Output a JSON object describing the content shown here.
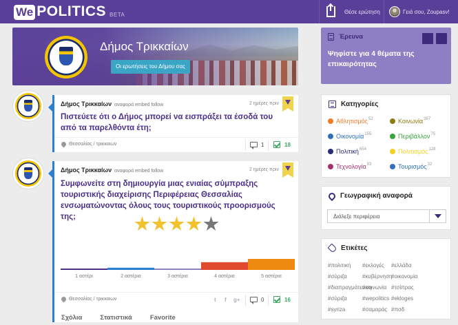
{
  "header": {
    "logo_we": "We",
    "logo_politics": "POLITICS",
    "logo_beta": "BETA",
    "ask_label": "Θέσε ερώτηση",
    "user_greeting": "Γειά σου, Zoupasv!"
  },
  "banner": {
    "title": "Δήμος Τρικκαίων",
    "button": "Οι ερωτήσεις του Δήμου σας"
  },
  "posts": [
    {
      "author": "Δήμος Τρικκαίων",
      "meta": "αναφορά embed follow",
      "time": "2 ημέρες πριν",
      "question": "Πιστεύετε ότι ο Δήμος μπορεί να εισπράξει τα έσοδά του από τα παρελθόντα έτη;",
      "location": "Θεσσαλίας / τρικκαιων",
      "comments": "1",
      "answers": "18"
    },
    {
      "author": "Δήμος Τρικκαίων",
      "meta": "αναφορά embed follow",
      "time": "2 ημέρες πριν",
      "question": "Συμφωνείτε στη δημιουργία μιας ενιαίας σύμπραξης τουριστικής διαχείρισης Περιφέρειας Θεσσαλίας ενσωματώνοντας όλους τους τουριστικούς προορισμούς της;",
      "location": "Θεσσαλίας / τρικκαιων",
      "social": [
        "t",
        "f",
        "g+"
      ],
      "comments": "0",
      "answers": "16",
      "rating": {
        "value": 4,
        "max": 5,
        "filled_color": "#f2c12e",
        "empty_color": "#777777"
      },
      "tabs": [
        "Σχόλια",
        "Στατιστικά",
        "Favorite"
      ]
    }
  ],
  "chart_data": {
    "type": "bar",
    "categories": [
      "1 αστέρι",
      "2 αστέρια",
      "3 αστέρια",
      "4 αστέρια",
      "5 αστέρια"
    ],
    "values": [
      1,
      2,
      1,
      7,
      10
    ],
    "colors": [
      "#4a2f8a",
      "#2d7fd2",
      "#8e7fc4",
      "#e04a2f",
      "#ee8a10"
    ],
    "ylim": [
      0,
      10
    ]
  },
  "survey": {
    "title": "Έρευνα",
    "text": "Ψηφίστε για 4 θέματα της επικαιρότητας"
  },
  "categories": {
    "title": "Κατηγορίες",
    "items": [
      {
        "label": "Αθλητισμός",
        "count": "52",
        "color": "#f07c2c"
      },
      {
        "label": "Κοινωνία",
        "count": "387",
        "color": "#8f7a12"
      },
      {
        "label": "Οικονομία",
        "count": "155",
        "color": "#2d6fb8"
      },
      {
        "label": "Περιβάλλον",
        "count": "75",
        "color": "#3aa43a"
      },
      {
        "label": "Πολιτική",
        "count": "654",
        "color": "#2b2f7a"
      },
      {
        "label": "Πολιτισμός",
        "count": "128",
        "color": "#f2d125"
      },
      {
        "label": "Τεχνολογία",
        "count": "93",
        "color": "#a8306b"
      },
      {
        "label": "Τουρισμός",
        "count": "32",
        "color": "#2d6fb8"
      }
    ]
  },
  "geo": {
    "title": "Γεωγραφική αναφορά",
    "select_value": "Διάλεξε περιφέρεια"
  },
  "tags": {
    "title": "Ετικέτες",
    "items": [
      "#πολιτική",
      "#εκλογές",
      "#ελλάδα",
      "#σύριζα",
      "#κυβέρνηση",
      "#οικονομία",
      "#διαπραγμάτευση",
      "#κοινωνία",
      "#τσίπρας",
      "#σύριζα",
      "#wepolitics",
      "#ekloges",
      "#syriza",
      "#σαμαράς",
      "#πσδ"
    ]
  }
}
